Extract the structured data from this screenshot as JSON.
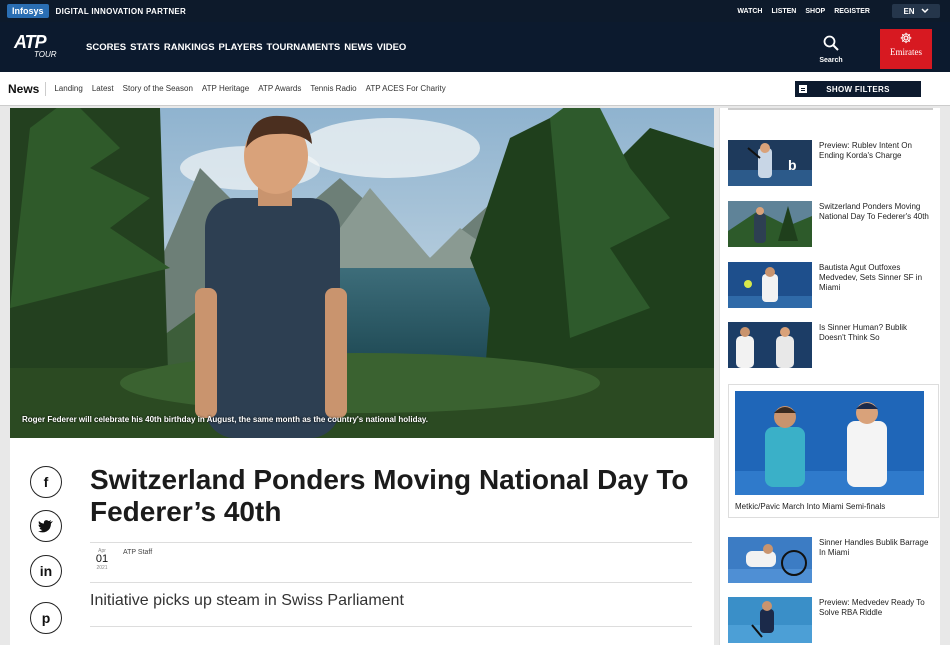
{
  "topbar": {
    "sponsor_logo": "Infosys",
    "sponsor_tagline": "DIGITAL INNOVATION PARTNER",
    "links": [
      "WATCH",
      "LISTEN",
      "SHOP",
      "REGISTER"
    ],
    "language": "EN"
  },
  "mainnav": {
    "logo_main": "ATP",
    "logo_sub": "TOUR",
    "links": [
      "SCORES",
      "STATS",
      "RANKINGS",
      "PLAYERS",
      "TOURNAMENTS",
      "NEWS",
      "VIDEO"
    ],
    "search_label": "Search",
    "partner": "Emirates"
  },
  "subnav": {
    "section": "News",
    "links": [
      "Landing",
      "Latest",
      "Story of the Season",
      "ATP Heritage",
      "ATP Awards",
      "Tennis Radio",
      "ATP ACES For Charity"
    ],
    "filters_label": "SHOW FILTERS"
  },
  "article": {
    "hero_caption": "Roger Federer will celebrate his 40th birthday in August, the same month as the country's national holiday.",
    "headline": "Switzerland Ponders Moving National Day To Federer’s 40th",
    "date_month": "Apr",
    "date_day": "01",
    "date_year": "2021",
    "author": "ATP Staff",
    "subtitle": "Initiative picks up steam in Swiss Parliament",
    "social": [
      "f",
      "t",
      "in",
      "p"
    ]
  },
  "sidebar": {
    "items": [
      {
        "title": "Preview: Rublev Intent On Ending Korda's Charge"
      },
      {
        "title": "Switzerland Ponders Moving National Day To Federer's 40th"
      },
      {
        "title": "Bautista Agut Outfoxes Medvedev, Sets Sinner SF in Miami"
      },
      {
        "title": "Is Sinner Human? Bublik Doesn't Think So"
      }
    ],
    "feature_caption": "Metkic/Pavic March Into Miami Semi-finals",
    "items2": [
      {
        "title": "Sinner Handles Bublik Barrage In Miami"
      },
      {
        "title": "Preview: Medvedev Ready To Solve RBA Riddle"
      }
    ]
  },
  "colors": {
    "navy": "#0c1a2e",
    "emirates_red": "#d71921",
    "infosys_blue": "#2a6eb3"
  }
}
